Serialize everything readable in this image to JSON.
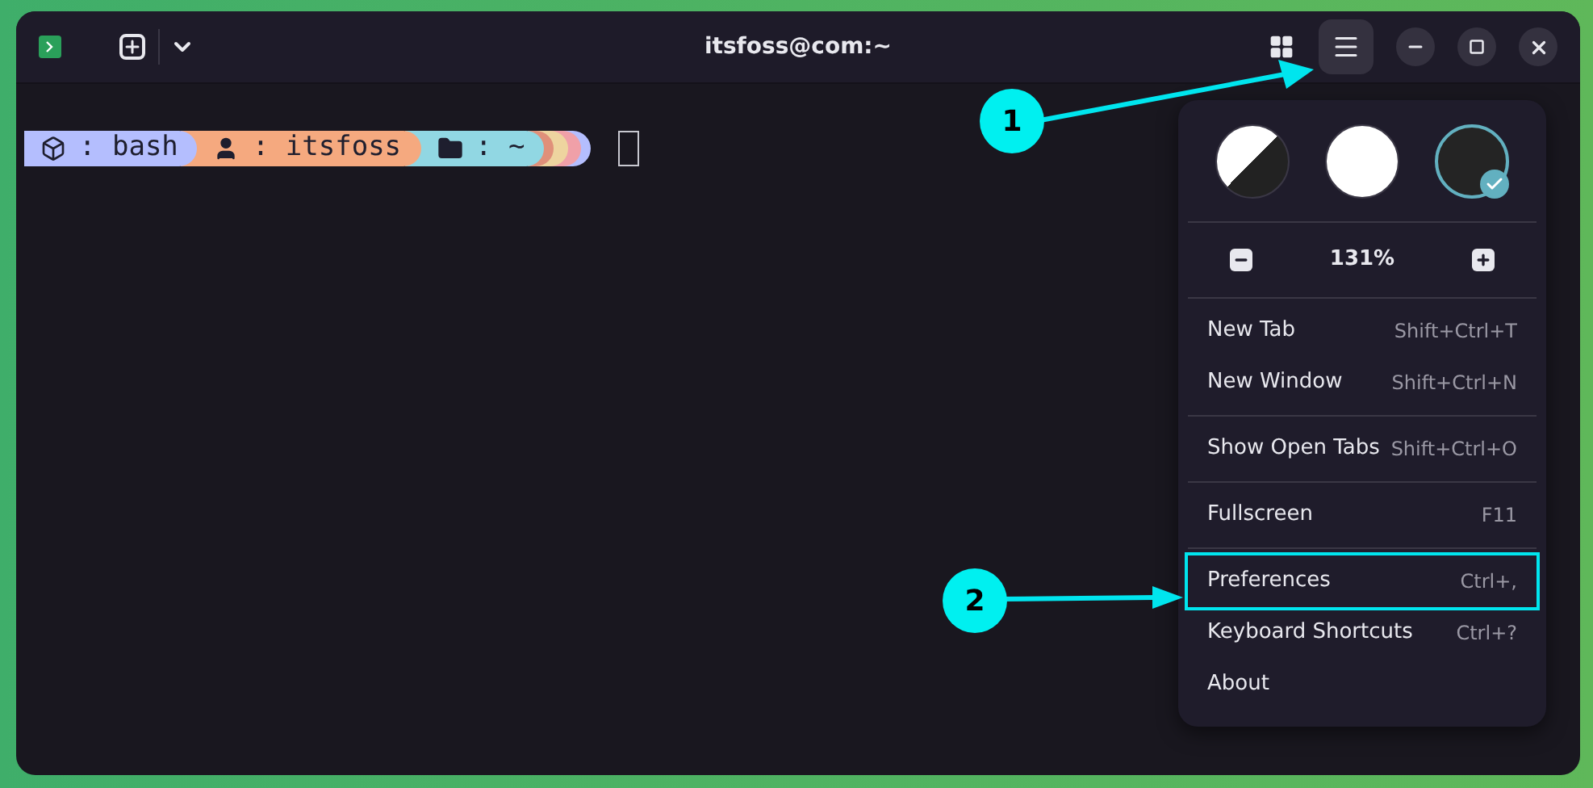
{
  "window": {
    "title": "itsfoss@com:~"
  },
  "prompt": {
    "segments": [
      {
        "kind": "shell",
        "text": ": bash",
        "color": "#b4befe"
      },
      {
        "kind": "user",
        "text": ": itsfoss",
        "color": "#f5a97f"
      },
      {
        "kind": "folder",
        "text": ": ~",
        "color": "#91d7e3"
      }
    ]
  },
  "menu": {
    "themes": [
      {
        "kind": "system",
        "selected": false
      },
      {
        "kind": "light",
        "selected": false
      },
      {
        "kind": "dark",
        "selected": true
      }
    ],
    "zoom": "131%",
    "sections": [
      [
        {
          "label": "New Tab",
          "shortcut": "Shift+Ctrl+T",
          "outlined": false
        },
        {
          "label": "New Window",
          "shortcut": "Shift+Ctrl+N",
          "outlined": false
        }
      ],
      [
        {
          "label": "Show Open Tabs",
          "shortcut": "Shift+Ctrl+O",
          "outlined": false
        }
      ],
      [
        {
          "label": "Fullscreen",
          "shortcut": "F11",
          "outlined": false
        }
      ],
      [
        {
          "label": "Preferences",
          "shortcut": "Ctrl+,",
          "outlined": true
        },
        {
          "label": "Keyboard Shortcuts",
          "shortcut": "Ctrl+?",
          "outlined": false
        },
        {
          "label": "About",
          "outlined": false
        }
      ]
    ]
  },
  "annotations": [
    {
      "label": "1"
    },
    {
      "label": "2"
    }
  ]
}
